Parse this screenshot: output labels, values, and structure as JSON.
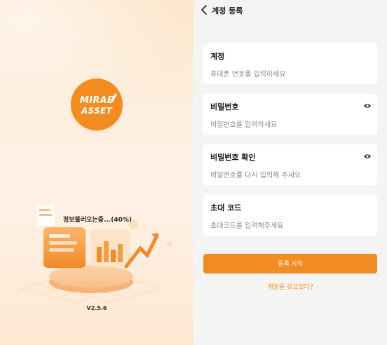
{
  "splash": {
    "logo_line1": "MIRAE",
    "logo_line2": "ASSET",
    "loading_text": "정보불러오는중...(40%)",
    "loading_progress": 0.4,
    "version": "V2.5.6"
  },
  "register": {
    "title": "계정 등록",
    "fields": [
      {
        "label": "계정",
        "placeholder": "휴대폰 번호를 입력하세요",
        "has_eye": false
      },
      {
        "label": "비밀번호",
        "placeholder": "비밀번호를 입력하세요",
        "has_eye": true
      },
      {
        "label": "비밀번호 확인",
        "placeholder": "비밀번호를 다시 입력해 주세요",
        "has_eye": true
      },
      {
        "label": "초대 코드",
        "placeholder": "초대코드를 입력해주세요",
        "has_eye": false
      }
    ],
    "submit_label": "등록 시작",
    "have_account_link": "계정을 갖고있다?",
    "icons": {
      "back": "chevron-left-icon",
      "eye": "eye-icon"
    }
  },
  "colors": {
    "accent": "#f28b20",
    "background": "#f4f4f4",
    "card": "#ffffff",
    "splash_bg": "#fdeedd"
  }
}
